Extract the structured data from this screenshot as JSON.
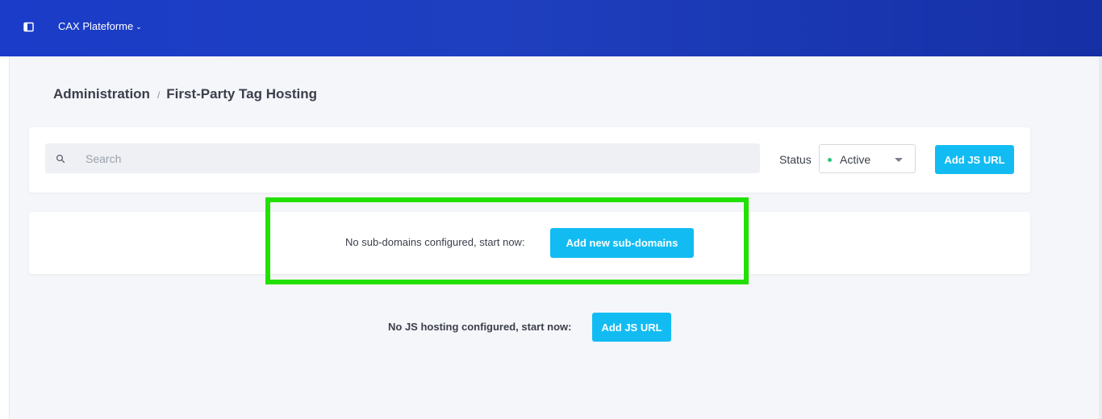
{
  "header": {
    "platform_name": "CAX Plateforme",
    "platform_chevron": "⌄",
    "sidebar_toggle_icon": "sidebar-toggle-icon",
    "background_color": "#1e3fbf"
  },
  "breadcrumb": {
    "parent": "Administration",
    "separator": "/",
    "current": "First-Party Tag Hosting"
  },
  "toolbar": {
    "search_placeholder": "Search",
    "search_value": "",
    "search_icon": "search-icon",
    "status_label": "Status",
    "status_value": "Active",
    "status_color": "#2fc47f",
    "add_js_label": "Add JS URL"
  },
  "subdomains": {
    "empty_text": "No sub-domains configured, start now:",
    "add_label": "Add new sub-domains"
  },
  "js_hosting": {
    "empty_text": "No JS hosting configured, start now:",
    "add_label": "Add JS URL"
  },
  "colors": {
    "accent": "#12bcf3",
    "highlight": "#22e000"
  }
}
